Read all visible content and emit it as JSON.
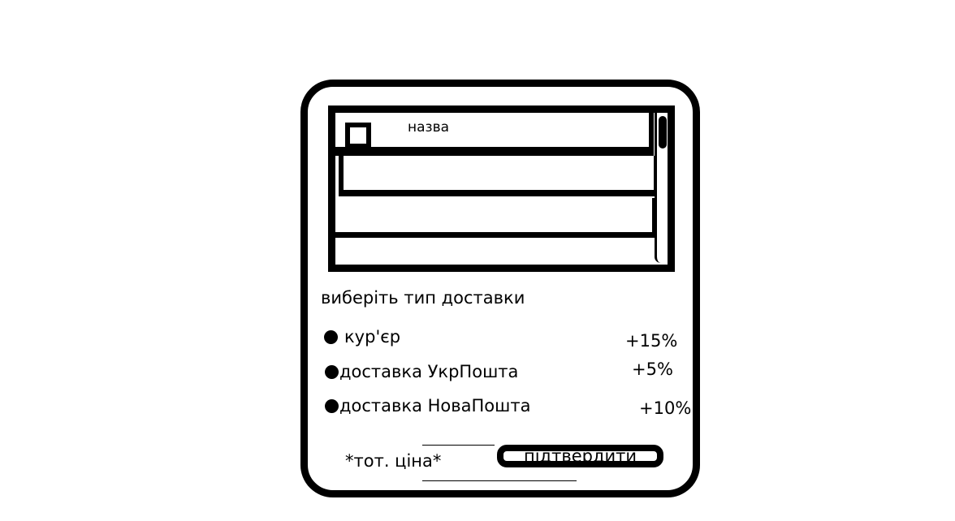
{
  "list": {
    "rows": [
      {
        "name": "назва"
      },
      {
        "name": ""
      },
      {
        "name": ""
      },
      {
        "name": ""
      }
    ]
  },
  "delivery": {
    "title": "виберіть тип доставки",
    "options": [
      {
        "label": "кур'єр",
        "surcharge": "+15%"
      },
      {
        "label": "доставка УкрПошта",
        "surcharge": "+5%"
      },
      {
        "label": "доставка НоваПошта",
        "surcharge": "+10%"
      }
    ]
  },
  "footer": {
    "total_label": "*тот. ціна*",
    "confirm_label": "підтвердити"
  }
}
